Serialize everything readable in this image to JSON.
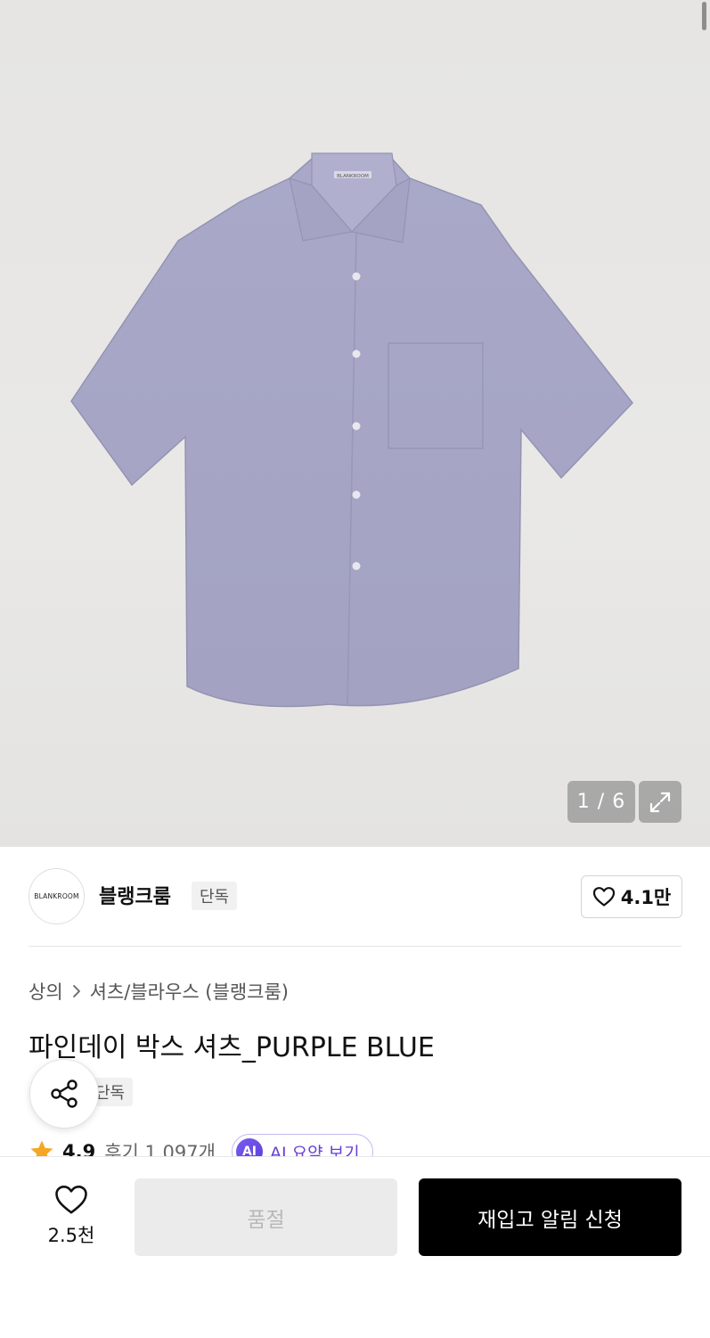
{
  "gallery": {
    "counter": "1 / 6",
    "shirt_label_text": "BLANKROOM"
  },
  "brand": {
    "logo_text": "BLANKROOM",
    "name": "블랭크룸",
    "badge": "단독",
    "likes": "4.1만"
  },
  "product": {
    "breadcrumb": [
      "상의",
      "셔츠/블라우스 (블랭크룸)"
    ],
    "title": "파인데이 박스 셔츠_PURPLE BLUE",
    "tag": "단독",
    "rating": "4.9",
    "reviews": "후기 1,097개",
    "ai_icon": "AI",
    "ai_summary_label": "AI 요약 보기"
  },
  "bottom_bar": {
    "wish_count": "2.5천",
    "soldout_label": "품절",
    "restock_label": "재입고 알림 신청"
  },
  "colors": {
    "shirt": "#a7a6c6",
    "accent_purple": "#6a3fd6",
    "star": "#f5a623",
    "cta_bg": "#000000"
  }
}
